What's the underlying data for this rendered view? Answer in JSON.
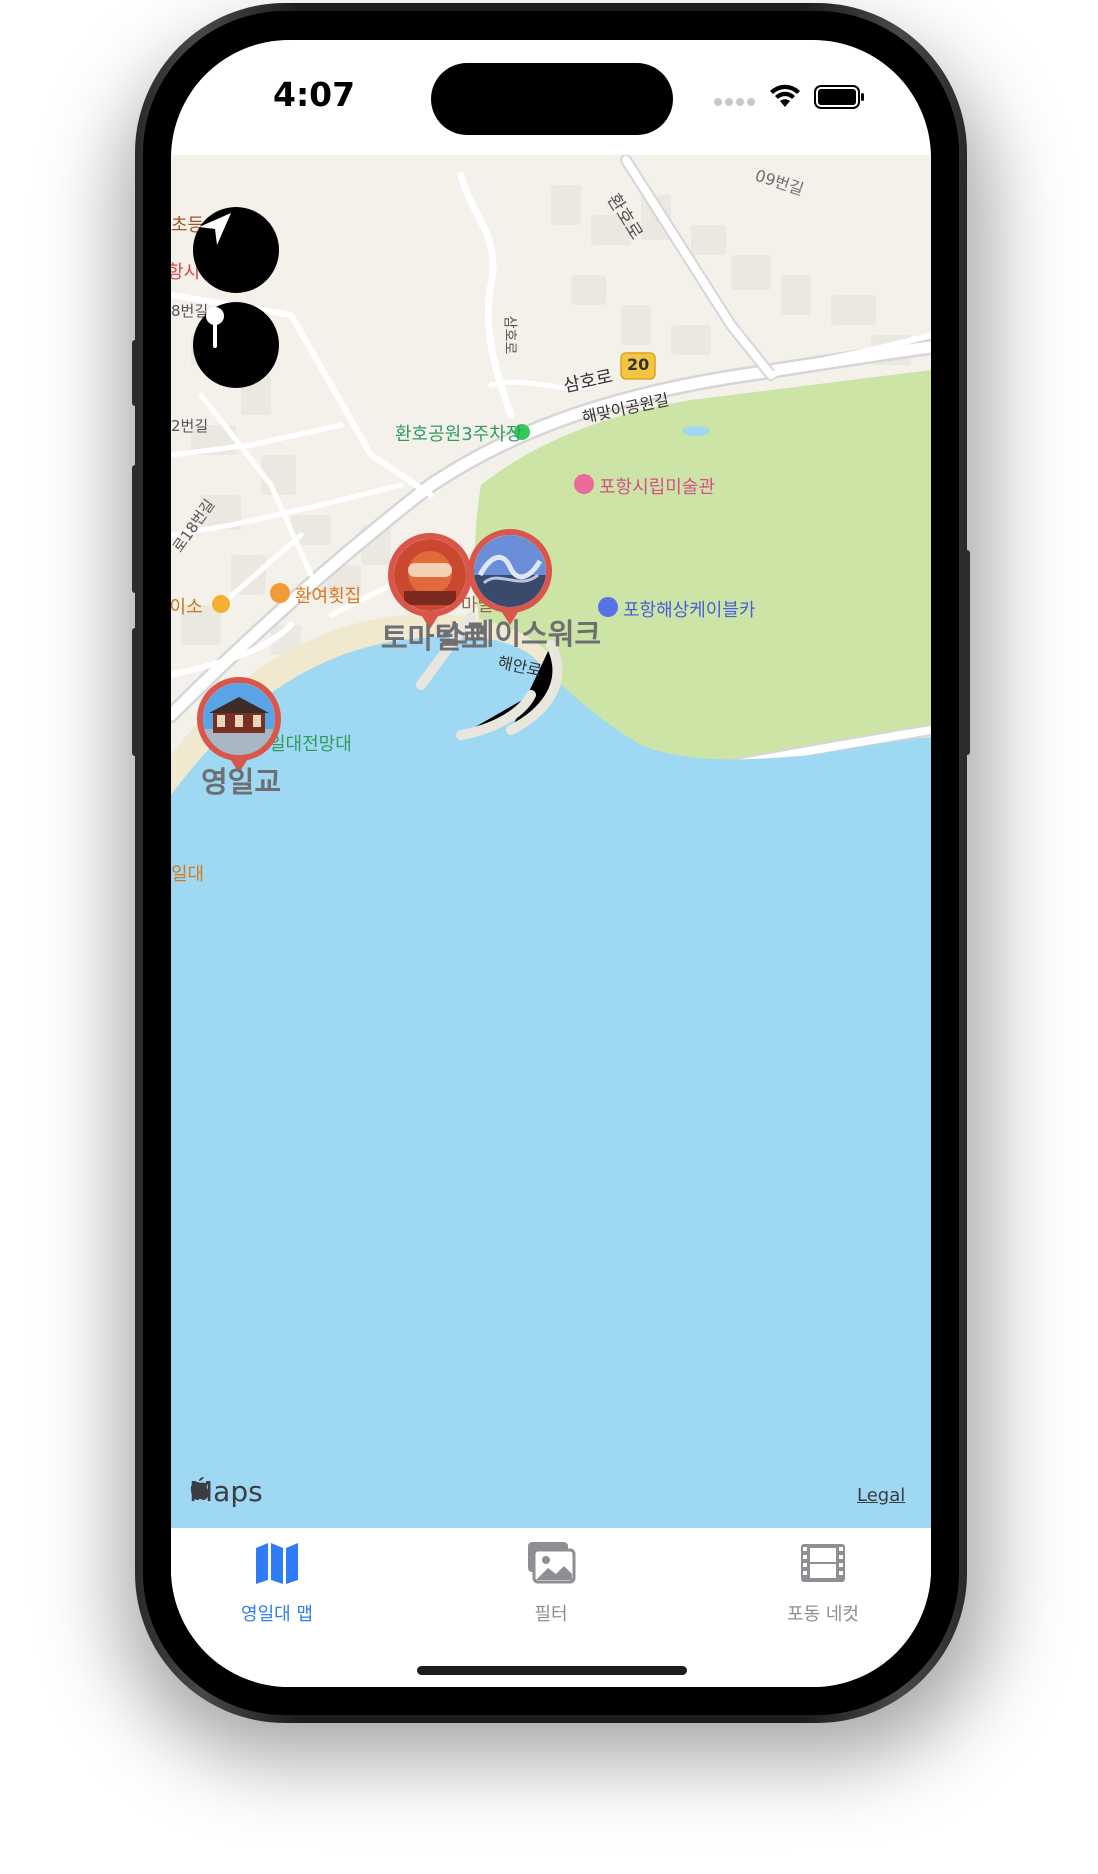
{
  "status_bar": {
    "time": "4:07"
  },
  "map": {
    "labels": {
      "road_top_right": "09번길",
      "road_hwanho": "환호로",
      "road_samho_vertical": "삼호로",
      "road_samho": "삼호로",
      "route_number": "20",
      "road_haemaji": "해맞이공원길",
      "parking": "환호공원3주차장",
      "museum": "포항시립미술관",
      "cablecar": "포항해상케이블카",
      "restaurant": "환여횟집",
      "daiso": "다이소",
      "observatory": "일대전망대",
      "road_haean": "해안로",
      "school_partial": "초등",
      "station_partial": "항시북",
      "road_18": "8번길",
      "road_2": "2번길",
      "road_18_diag": "로18번길",
      "yeongil_partial": "일대",
      "tomato_partial": "마달"
    },
    "pins": [
      {
        "title": "토마틸로",
        "id": "tomatillo"
      },
      {
        "title": "스페이스워크",
        "id": "spacewalk"
      },
      {
        "title": "영일교",
        "id": "yeongilgyo"
      }
    ],
    "brand": "Maps",
    "legal": "Legal"
  },
  "tabbar": {
    "tabs": [
      {
        "label": "영일대 맵",
        "icon": "map-icon",
        "active": true
      },
      {
        "label": "필터",
        "icon": "photos-icon",
        "active": false
      },
      {
        "label": "포동 네컷",
        "icon": "film-icon",
        "active": false
      }
    ],
    "active_color": "#2f7cf6",
    "inactive_color": "#8e8e93"
  },
  "colors": {
    "sea": "#9fd8f2",
    "park": "#cce4a6",
    "land": "#f4f1ea",
    "pin_ring": "#d9574a"
  }
}
